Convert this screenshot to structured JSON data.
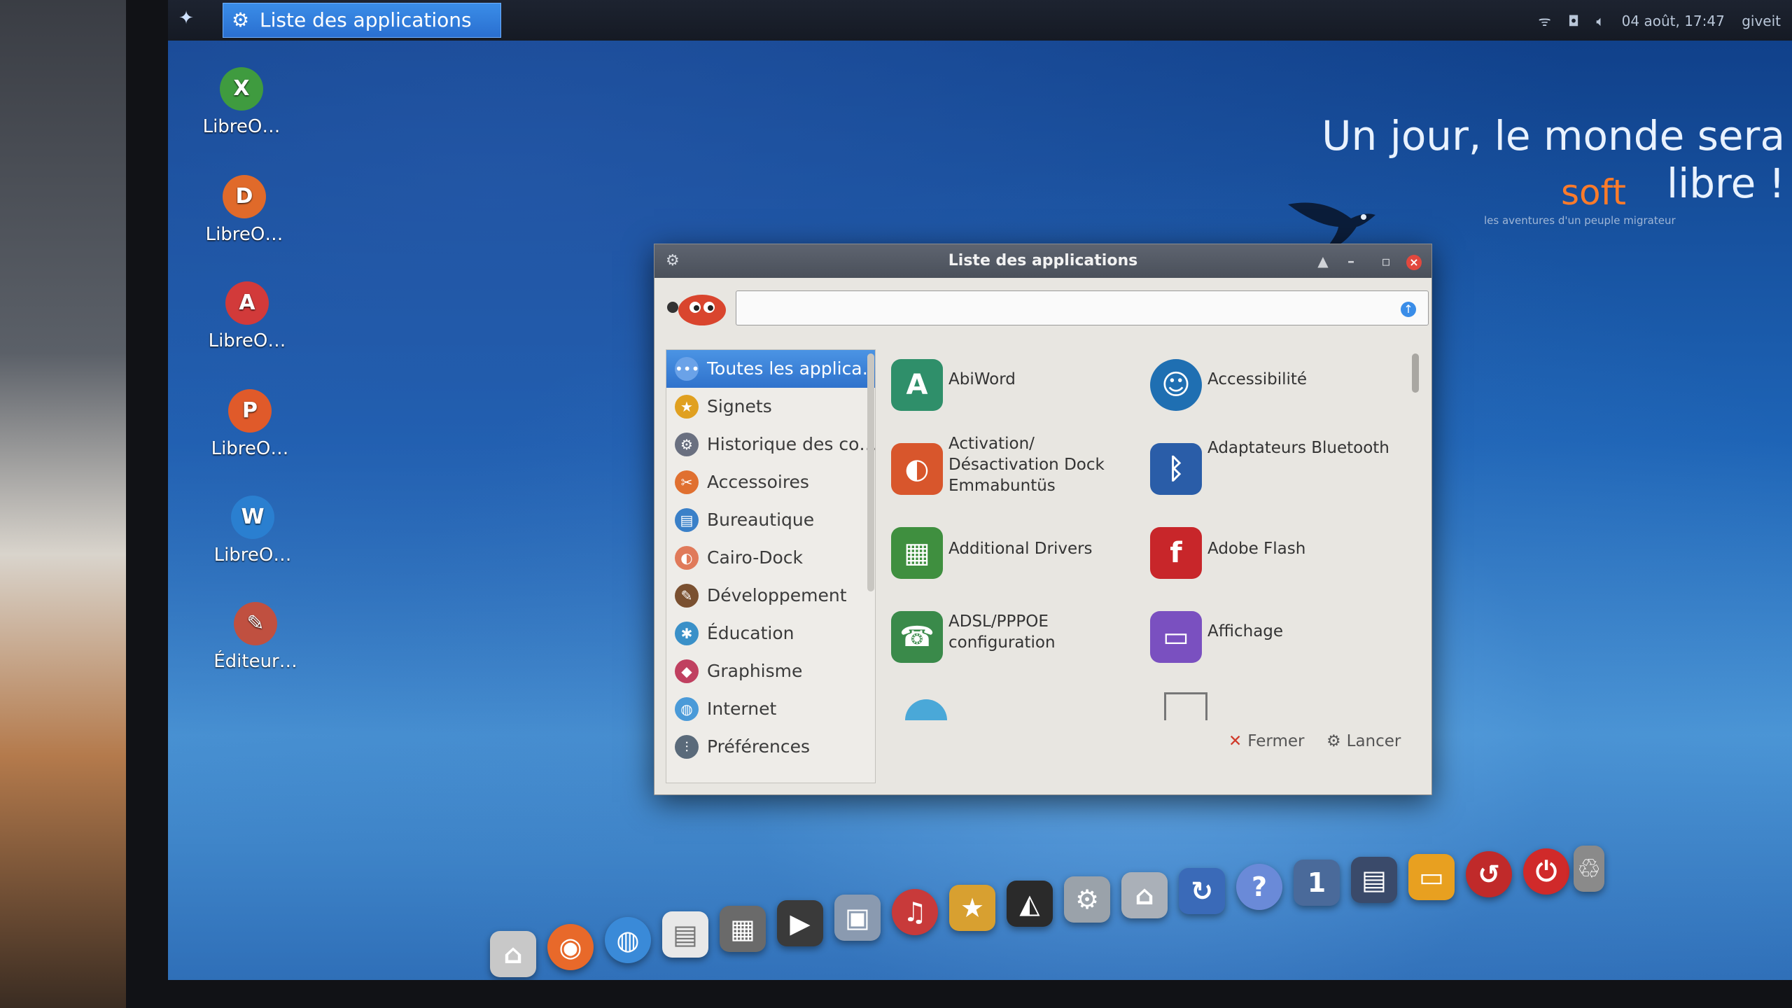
{
  "top_panel": {
    "menu_icon": "emmabuntus-menu-icon",
    "task_button": "Liste des applications",
    "tray": {
      "datetime": "04 août, 17:47",
      "user": "giveit"
    }
  },
  "wallpaper": {
    "slogan": "Un jour, le monde sera libre !",
    "brand": "soft",
    "brand_sub": "les aventures d'un peuple migrateur"
  },
  "desktop_icons": [
    {
      "label": "LibreO…",
      "icon": "libreoffice-calc-icon",
      "letter": "X",
      "color": "#3f9b3f"
    },
    {
      "label": "LibreO…",
      "icon": "libreoffice-draw-icon",
      "letter": "D",
      "color": "#e06a2a"
    },
    {
      "label": "LibreO…",
      "icon": "libreoffice-base-icon",
      "letter": "A",
      "color": "#d23a3a"
    },
    {
      "label": "LibreO…",
      "icon": "libreoffice-impress-icon",
      "letter": "P",
      "color": "#e05a2a"
    },
    {
      "label": "LibreO…",
      "icon": "libreoffice-writer-icon",
      "letter": "W",
      "color": "#2a7fd0"
    },
    {
      "label": "Éditeur…",
      "icon": "editor-mascot-icon",
      "letter": "✎",
      "color": "#c05040"
    }
  ],
  "dialog": {
    "title": "Liste des applications",
    "search": {
      "value": "",
      "placeholder": ""
    },
    "categories": [
      {
        "label": "Toutes les applica…",
        "icon": "all-apps-icon",
        "color": "#6aa2e8",
        "selected": true
      },
      {
        "label": "Signets",
        "icon": "star-icon",
        "color": "#e0a020"
      },
      {
        "label": "Historique des co…",
        "icon": "gears-icon",
        "color": "#6a7080"
      },
      {
        "label": "Accessoires",
        "icon": "accessories-icon",
        "color": "#e07030"
      },
      {
        "label": "Bureautique",
        "icon": "office-icon",
        "color": "#3a80c8"
      },
      {
        "label": "Cairo-Dock",
        "icon": "cairo-dock-icon",
        "color": "#e07a5a"
      },
      {
        "label": "Développement",
        "icon": "development-icon",
        "color": "#7a5030"
      },
      {
        "label": "Éducation",
        "icon": "education-icon",
        "color": "#3a90c8"
      },
      {
        "label": "Graphisme",
        "icon": "graphics-icon",
        "color": "#c04060"
      },
      {
        "label": "Internet",
        "icon": "internet-icon",
        "color": "#4a9ad8"
      },
      {
        "label": "Préférences",
        "icon": "preferences-icon",
        "color": "#5a6a7a"
      }
    ],
    "apps": [
      {
        "name": "AbiWord",
        "icon": "abiword-icon",
        "letter": "A",
        "color": "#2f8f6a"
      },
      {
        "name": "Accessibilité",
        "icon": "accessibility-icon",
        "letter": "☺",
        "color": "#1f6fb2"
      },
      {
        "name": "Activation/ Désactivation Dock Emmabuntüs",
        "icon": "dock-toggle-icon",
        "letter": "◐",
        "color": "#d8562c"
      },
      {
        "name": "Adaptateurs Bluetooth",
        "icon": "bluetooth-icon",
        "letter": "ᛒ",
        "color": "#2a5da8"
      },
      {
        "name": "Additional Drivers",
        "icon": "drivers-icon",
        "letter": "▦",
        "color": "#3f8f3f"
      },
      {
        "name": "Adobe Flash",
        "icon": "flash-icon",
        "letter": "f",
        "color": "#c8262a"
      },
      {
        "name": "ADSL/PPPOE configuration",
        "icon": "adsl-icon",
        "letter": "☎",
        "color": "#3a8a4a"
      },
      {
        "name": "Affichage",
        "icon": "display-icon",
        "letter": "▭",
        "color": "#7a50c0"
      }
    ],
    "buttons": {
      "close": "Fermer",
      "launch": "Lancer"
    }
  },
  "dock_icons": [
    {
      "icon": "home-icon",
      "glyph": "⌂",
      "color": "#c8c8c8"
    },
    {
      "icon": "firefox-icon",
      "glyph": "◉",
      "color": "#e8692a"
    },
    {
      "icon": "globe-icon",
      "glyph": "◍",
      "color": "#3a8ad8"
    },
    {
      "icon": "document-icon",
      "glyph": "▤",
      "color": "#e8e8e8"
    },
    {
      "icon": "calendar-icon",
      "glyph": "▦",
      "color": "#6a6a6a"
    },
    {
      "icon": "video-icon",
      "glyph": "▶",
      "color": "#3a3a3a"
    },
    {
      "icon": "photo-icon",
      "glyph": "▣",
      "color": "#8a9ab0"
    },
    {
      "icon": "audio-icon",
      "glyph": "♫",
      "color": "#c83a3a"
    },
    {
      "icon": "favorites-star-icon",
      "glyph": "★",
      "color": "#d8a030"
    },
    {
      "icon": "linux-tux-icon",
      "glyph": "◭",
      "color": "#2a2a2a"
    },
    {
      "icon": "settings-gear-icon",
      "glyph": "⚙",
      "color": "#9aa2aa"
    },
    {
      "icon": "house-settings-icon",
      "glyph": "⌂",
      "color": "#aab0b8"
    },
    {
      "icon": "update-icon",
      "glyph": "↻",
      "color": "#3a6ab8"
    },
    {
      "icon": "help-icon",
      "glyph": "?",
      "color": "#6a8ad8"
    },
    {
      "icon": "workspaces-icon",
      "glyph": "1",
      "color": "#4a6a9a"
    },
    {
      "icon": "window-icon",
      "glyph": "▤",
      "color": "#3a4a6a"
    },
    {
      "icon": "notes-icon",
      "glyph": "▭",
      "color": "#e8a020"
    },
    {
      "icon": "refresh-swirl-icon",
      "glyph": "↺",
      "color": "#c02a2a"
    },
    {
      "icon": "power-icon",
      "glyph": "⏻",
      "color": "#d02a2a"
    },
    {
      "icon": "trash-icon",
      "glyph": "♲",
      "color": "#8a8a8a"
    }
  ]
}
